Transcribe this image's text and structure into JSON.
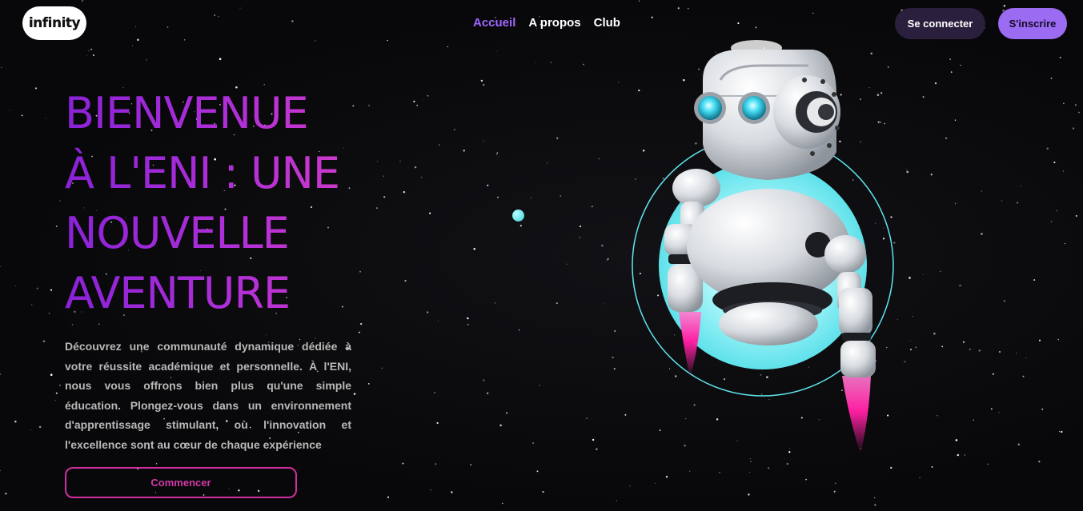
{
  "header": {
    "logo_text": "infinity",
    "nav": [
      {
        "label": "Accueil",
        "active": true
      },
      {
        "label": "A propos",
        "active": false
      },
      {
        "label": "Club",
        "active": false
      }
    ],
    "login_label": "Se connecter",
    "signup_label": "S'inscrire"
  },
  "hero": {
    "title_lines": [
      "BIENVENUE",
      "À L'ENI : UNE",
      "NOUVELLE",
      "AVENTURE"
    ],
    "description": "Découvrez une communauté dynamique dédiée à votre réussite académique et personnelle. À l'ENI, nous vous offrons bien plus qu'une simple éducation. Plongez-vous dans un environnement d'apprentissage stimulant, où l'innovation et l'excellence sont au cœur de chaque expérience",
    "cta_label": "Commencer"
  },
  "illustration": {
    "robot_icon": "robot-illustration-icon",
    "accent_colors": {
      "glow": "#8ff4f8",
      "ring": "#5fe6ee",
      "eyes": "#3fd8f0",
      "thrusters": "#ff2fa8"
    }
  },
  "colors": {
    "background": "#0a0a0c",
    "accent_purple": "#9b6bf2",
    "nav_active": "#a066ff",
    "title_gradient": [
      "#8a22d8",
      "#d43bc8"
    ],
    "cta_border": "#d02f9e"
  }
}
